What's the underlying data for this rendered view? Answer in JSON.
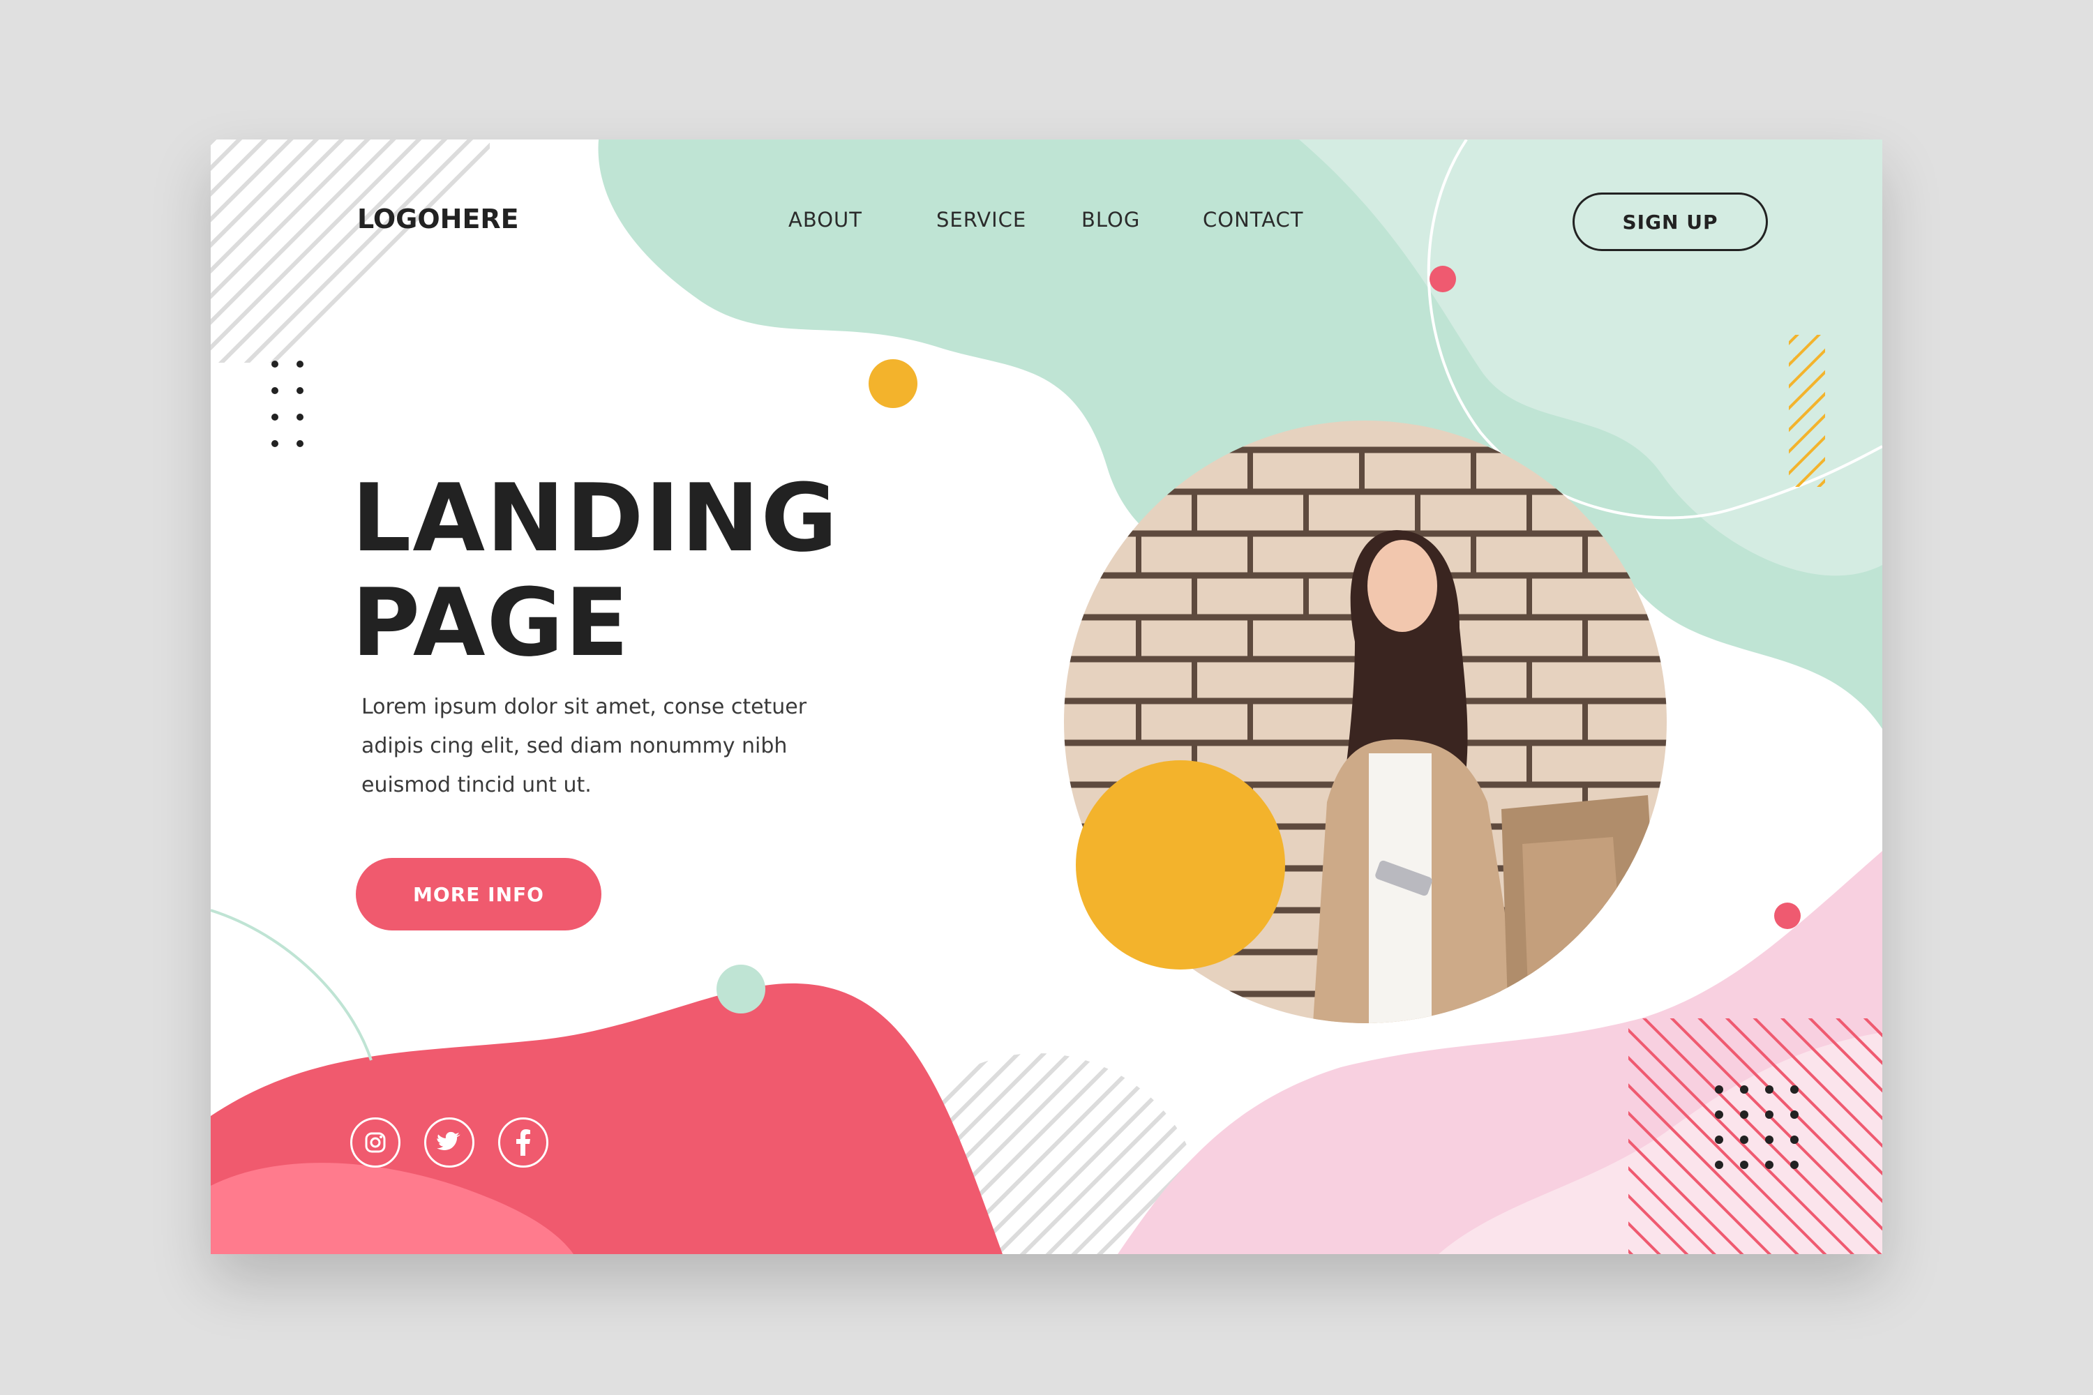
{
  "header": {
    "logo": "LOGOHERE",
    "nav": [
      "ABOUT",
      "SERVICE",
      "BLOG",
      "CONTACT"
    ],
    "signup_label": "SIGN UP"
  },
  "hero": {
    "title_line1": "LANDING",
    "title_line2": "PAGE",
    "description_lines": [
      "Lorem ipsum dolor sit amet, conse ctetuer",
      "adipis cing elit, sed diam nonummy nibh",
      "euismod tincid unt ut."
    ],
    "cta_label": "MORE INFO"
  },
  "social": [
    "instagram-icon",
    "twitter-icon",
    "facebook-icon"
  ],
  "colors": {
    "mint": "#bfe4d4",
    "mint_light": "#d4ece2",
    "coral": "#f05a6e",
    "coral_light": "#ff7b8d",
    "pink": "#f8d0e0",
    "pink_light": "#fbe4ec",
    "yellow": "#f3b32c",
    "text_dark": "#222222"
  }
}
